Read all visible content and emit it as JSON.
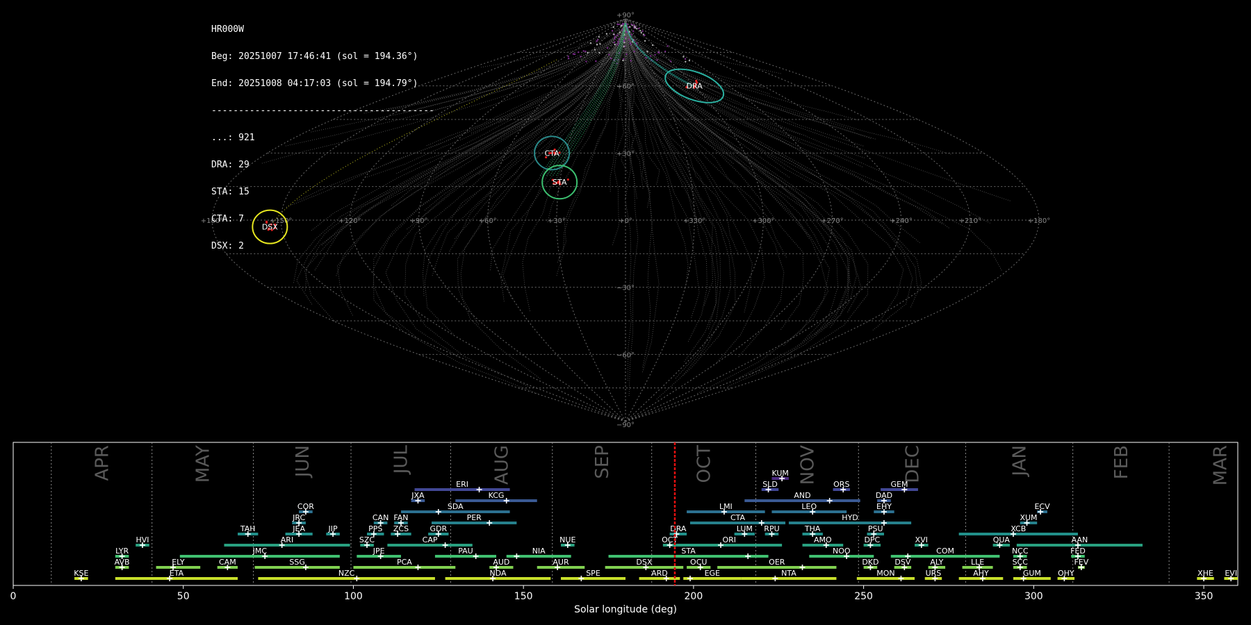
{
  "info": {
    "station": "HR000W",
    "beg": "Beg: 20251007 17:46:41 (sol = 194.36°)",
    "end": "End: 20251008 04:17:03 (sol = 194.79°)",
    "separator": "-----------------------------------------",
    "counts": [
      "...: 921",
      "DRA: 29",
      "STA: 15",
      "CTA: 7",
      "DSX: 2"
    ]
  },
  "sky_map": {
    "lon_labels": [
      "+180°",
      "+150°",
      "+120°",
      "+90°",
      "+60°",
      "+30°",
      "+0°",
      "+330°",
      "+300°",
      "+270°",
      "+240°",
      "+210°",
      "+180°"
    ],
    "lat_labels": [
      "+90°",
      "+60°",
      "+30°",
      "−30°",
      "−60°",
      "−90°"
    ],
    "showers": [
      {
        "code": "DRA",
        "lon": -60,
        "lat": 60,
        "color": "#2ab0a0"
      },
      {
        "code": "CTA",
        "lon": 37,
        "lat": 30,
        "color": "#2a8a8a"
      },
      {
        "code": "STA",
        "lon": 30,
        "lat": 17,
        "color": "#3cc070"
      },
      {
        "code": "DSX",
        "lon": 155,
        "lat": -3,
        "color": "#e8e820"
      }
    ]
  },
  "chart_data": {
    "type": "timeline",
    "xlabel": "Solar longitude (deg)",
    "xlim": [
      0,
      360
    ],
    "x_ticks": [
      "0",
      "50",
      "100",
      "150",
      "200",
      "250",
      "300",
      "350"
    ],
    "current_sol": 194.5,
    "months": [
      {
        "label": "APR",
        "start": 11.2
      },
      {
        "label": "MAY",
        "start": 40.8
      },
      {
        "label": "JUN",
        "start": 70.6
      },
      {
        "label": "JUL",
        "start": 99.3
      },
      {
        "label": "AUG",
        "start": 128.6
      },
      {
        "label": "SEP",
        "start": 158.5
      },
      {
        "label": "OCT",
        "start": 187.7
      },
      {
        "label": "NOV",
        "start": 218.3
      },
      {
        "label": "DEC",
        "start": 248.5
      },
      {
        "label": "JAN",
        "start": 280.0
      },
      {
        "label": "FEB",
        "start": 311.5
      },
      {
        "label": "MAR",
        "start": 339.8
      }
    ],
    "showers": [
      {
        "code": "KSE",
        "start": 18,
        "end": 22,
        "peak": 20,
        "row": 0,
        "color": "#c8df2a"
      },
      {
        "code": "ETA",
        "start": 30,
        "end": 66,
        "peak": 46,
        "row": 0,
        "color": "#c8df2a"
      },
      {
        "code": "NZC",
        "start": 72,
        "end": 124,
        "peak": 101,
        "row": 0,
        "color": "#c8df2a"
      },
      {
        "code": "NDA",
        "start": 127,
        "end": 158,
        "peak": 141,
        "row": 0,
        "color": "#c8df2a"
      },
      {
        "code": "SPE",
        "start": 161,
        "end": 180,
        "peak": 167,
        "row": 0,
        "color": "#c8df2a"
      },
      {
        "code": "ARD",
        "start": 184,
        "end": 196,
        "peak": 192,
        "row": 0,
        "color": "#c8df2a"
      },
      {
        "code": "EGE",
        "start": 197,
        "end": 214,
        "peak": 199,
        "row": 0,
        "color": "#c8df2a"
      },
      {
        "code": "NTA",
        "start": 214,
        "end": 242,
        "peak": 224,
        "row": 0,
        "color": "#c8df2a"
      },
      {
        "code": "MON",
        "start": 248,
        "end": 265,
        "peak": 261,
        "row": 0,
        "color": "#c8df2a"
      },
      {
        "code": "URS",
        "start": 268,
        "end": 273,
        "peak": 271,
        "row": 0,
        "color": "#c8df2a"
      },
      {
        "code": "AHY",
        "start": 278,
        "end": 291,
        "peak": 285,
        "row": 0,
        "color": "#c8df2a"
      },
      {
        "code": "GUM",
        "start": 294,
        "end": 305,
        "peak": 297,
        "row": 0,
        "color": "#c8df2a"
      },
      {
        "code": "OHY",
        "start": 307,
        "end": 312,
        "peak": 309,
        "row": 0,
        "color": "#c8df2a"
      },
      {
        "code": "XHE",
        "start": 348,
        "end": 353,
        "peak": 350,
        "row": 0,
        "color": "#c8df2a"
      },
      {
        "code": "EVI",
        "start": 356,
        "end": 360,
        "peak": 358,
        "row": 0,
        "color": "#c8df2a"
      },
      {
        "code": "AVB",
        "start": 30,
        "end": 34,
        "peak": 32,
        "row": 1,
        "color": "#80d050"
      },
      {
        "code": "ELY",
        "start": 42,
        "end": 55,
        "peak": 47,
        "row": 1,
        "color": "#80d050"
      },
      {
        "code": "CAM",
        "start": 60,
        "end": 66,
        "peak": 63,
        "row": 1,
        "color": "#80d050"
      },
      {
        "code": "SSG",
        "start": 71,
        "end": 96,
        "peak": 86,
        "row": 1,
        "color": "#80d050"
      },
      {
        "code": "PCA",
        "start": 100,
        "end": 130,
        "peak": 119,
        "row": 1,
        "color": "#80d050"
      },
      {
        "code": "AUD",
        "start": 140,
        "end": 147,
        "peak": 142,
        "row": 1,
        "color": "#80d050"
      },
      {
        "code": "AUR",
        "start": 154,
        "end": 168,
        "peak": 160,
        "row": 1,
        "color": "#80d050"
      },
      {
        "code": "DSX",
        "start": 174,
        "end": 197,
        "peak": 186,
        "row": 1,
        "color": "#80d050"
      },
      {
        "code": "OCU",
        "start": 198,
        "end": 205,
        "peak": 202,
        "row": 1,
        "color": "#80d050"
      },
      {
        "code": "OER",
        "start": 207,
        "end": 242,
        "peak": 232,
        "row": 1,
        "color": "#80d050"
      },
      {
        "code": "DKD",
        "start": 250,
        "end": 254,
        "peak": 252,
        "row": 1,
        "color": "#80d050"
      },
      {
        "code": "DSV",
        "start": 259,
        "end": 264,
        "peak": 262,
        "row": 1,
        "color": "#80d050"
      },
      {
        "code": "ALY",
        "start": 269,
        "end": 274,
        "peak": 271,
        "row": 1,
        "color": "#80d050"
      },
      {
        "code": "LLE",
        "start": 279,
        "end": 288,
        "peak": 284,
        "row": 1,
        "color": "#80d050"
      },
      {
        "code": "SCC",
        "start": 294,
        "end": 298,
        "peak": 296,
        "row": 1,
        "color": "#80d050"
      },
      {
        "code": "FEV",
        "start": 313,
        "end": 315,
        "peak": 314,
        "row": 1,
        "color": "#80d050"
      },
      {
        "code": "LYR",
        "start": 30,
        "end": 34,
        "peak": 32,
        "row": 2,
        "color": "#40c070"
      },
      {
        "code": "JMC",
        "start": 49,
        "end": 96,
        "peak": 74,
        "row": 2,
        "color": "#40c070"
      },
      {
        "code": "JPE",
        "start": 101,
        "end": 114,
        "peak": 108,
        "row": 2,
        "color": "#40c070"
      },
      {
        "code": "PAU",
        "start": 124,
        "end": 142,
        "peak": 136,
        "row": 2,
        "color": "#40c070"
      },
      {
        "code": "NIA",
        "start": 145,
        "end": 164,
        "peak": 148,
        "row": 2,
        "color": "#40c070"
      },
      {
        "code": "STA",
        "start": 175,
        "end": 222,
        "peak": 216,
        "row": 2,
        "color": "#40c070"
      },
      {
        "code": "NOO",
        "start": 234,
        "end": 253,
        "peak": 245,
        "row": 2,
        "color": "#40c070"
      },
      {
        "code": "COM",
        "start": 258,
        "end": 290,
        "peak": 263,
        "row": 2,
        "color": "#40c070"
      },
      {
        "code": "NCC",
        "start": 294,
        "end": 298,
        "peak": 296,
        "row": 2,
        "color": "#40c070"
      },
      {
        "code": "FED",
        "start": 311,
        "end": 315,
        "peak": 313,
        "row": 2,
        "color": "#40c070"
      },
      {
        "code": "HVI",
        "start": 36,
        "end": 40,
        "peak": 38,
        "row": 3,
        "color": "#28a080"
      },
      {
        "code": "ARI",
        "start": 62,
        "end": 99,
        "peak": 79,
        "row": 3,
        "color": "#28a080"
      },
      {
        "code": "SZC",
        "start": 102,
        "end": 106,
        "peak": 104,
        "row": 3,
        "color": "#28a080"
      },
      {
        "code": "CAP",
        "start": 110,
        "end": 135,
        "peak": 127,
        "row": 3,
        "color": "#28a080"
      },
      {
        "code": "NUE",
        "start": 161,
        "end": 165,
        "peak": 163,
        "row": 3,
        "color": "#28a080"
      },
      {
        "code": "OCT",
        "start": 191,
        "end": 195,
        "peak": 193,
        "row": 3,
        "color": "#28a080"
      },
      {
        "code": "ORI",
        "start": 195,
        "end": 226,
        "peak": 208,
        "row": 3,
        "color": "#28a080"
      },
      {
        "code": "AMO",
        "start": 232,
        "end": 244,
        "peak": 239,
        "row": 3,
        "color": "#28a080"
      },
      {
        "code": "DPC",
        "start": 250,
        "end": 255,
        "peak": 252,
        "row": 3,
        "color": "#28a080"
      },
      {
        "code": "XVI",
        "start": 265,
        "end": 269,
        "peak": 267,
        "row": 3,
        "color": "#28a080"
      },
      {
        "code": "QUA",
        "start": 288,
        "end": 293,
        "peak": 290,
        "row": 3,
        "color": "#28a080"
      },
      {
        "code": "AAN",
        "start": 295,
        "end": 332,
        "peak": 313,
        "row": 3,
        "color": "#28a080"
      },
      {
        "code": "TAH",
        "start": 66,
        "end": 72,
        "peak": 69,
        "row": 4,
        "color": "#22908a"
      },
      {
        "code": "JEA",
        "start": 80,
        "end": 88,
        "peak": 84,
        "row": 4,
        "color": "#22908a"
      },
      {
        "code": "JIP",
        "start": 92,
        "end": 96,
        "peak": 94,
        "row": 4,
        "color": "#22908a"
      },
      {
        "code": "PPS",
        "start": 104,
        "end": 109,
        "peak": 106,
        "row": 4,
        "color": "#22908a"
      },
      {
        "code": "ZCS",
        "start": 111,
        "end": 117,
        "peak": 113,
        "row": 4,
        "color": "#22908a"
      },
      {
        "code": "GDR",
        "start": 122,
        "end": 128,
        "peak": 125,
        "row": 4,
        "color": "#22908a"
      },
      {
        "code": "DRA",
        "start": 193,
        "end": 198,
        "peak": 195,
        "row": 4,
        "color": "#22908a"
      },
      {
        "code": "LUM",
        "start": 212,
        "end": 218,
        "peak": 215,
        "row": 4,
        "color": "#22908a"
      },
      {
        "code": "RPU",
        "start": 221,
        "end": 225,
        "peak": 223,
        "row": 4,
        "color": "#22908a"
      },
      {
        "code": "THA",
        "start": 232,
        "end": 238,
        "peak": 235,
        "row": 4,
        "color": "#22908a"
      },
      {
        "code": "PSU",
        "start": 251,
        "end": 256,
        "peak": 253,
        "row": 4,
        "color": "#22908a"
      },
      {
        "code": "XCB",
        "start": 278,
        "end": 313,
        "peak": 294,
        "row": 4,
        "color": "#22908a"
      },
      {
        "code": "JRC",
        "start": 82,
        "end": 86,
        "peak": 84,
        "row": 5,
        "color": "#26808c"
      },
      {
        "code": "CAN",
        "start": 106,
        "end": 110,
        "peak": 108,
        "row": 5,
        "color": "#26808c"
      },
      {
        "code": "FAN",
        "start": 112,
        "end": 116,
        "peak": 114,
        "row": 5,
        "color": "#26808c"
      },
      {
        "code": "PER",
        "start": 123,
        "end": 148,
        "peak": 140,
        "row": 5,
        "color": "#26808c"
      },
      {
        "code": "CTA",
        "start": 199,
        "end": 227,
        "peak": 220,
        "row": 5,
        "color": "#26808c"
      },
      {
        "code": "HYD",
        "start": 228,
        "end": 264,
        "peak": 256,
        "row": 5,
        "color": "#26808c"
      },
      {
        "code": "XUM",
        "start": 296,
        "end": 301,
        "peak": 298,
        "row": 5,
        "color": "#26808c"
      },
      {
        "code": "COR",
        "start": 84,
        "end": 88,
        "peak": 86,
        "row": 6,
        "color": "#2c7090"
      },
      {
        "code": "SDA",
        "start": 114,
        "end": 146,
        "peak": 125,
        "row": 6,
        "color": "#2c7090"
      },
      {
        "code": "LMI",
        "start": 198,
        "end": 221,
        "peak": 209,
        "row": 6,
        "color": "#2c7090"
      },
      {
        "code": "LEO",
        "start": 223,
        "end": 245,
        "peak": 235,
        "row": 6,
        "color": "#2c7090"
      },
      {
        "code": "EHY",
        "start": 253,
        "end": 259,
        "peak": 256,
        "row": 6,
        "color": "#2c7090"
      },
      {
        "code": "ECV",
        "start": 301,
        "end": 304,
        "peak": 302,
        "row": 6,
        "color": "#2c7090"
      },
      {
        "code": "JXA",
        "start": 117,
        "end": 121,
        "peak": 119,
        "row": 7,
        "color": "#3a5a94"
      },
      {
        "code": "KCG",
        "start": 130,
        "end": 154,
        "peak": 145,
        "row": 7,
        "color": "#3a5a94"
      },
      {
        "code": "AND",
        "start": 215,
        "end": 249,
        "peak": 240,
        "row": 7,
        "color": "#3a5a94"
      },
      {
        "code": "DAD",
        "start": 254,
        "end": 258,
        "peak": 256,
        "row": 7,
        "color": "#3a5a94"
      },
      {
        "code": "ERI",
        "start": 118,
        "end": 146,
        "peak": 137,
        "row": 8,
        "color": "#424896"
      },
      {
        "code": "SLD",
        "start": 220,
        "end": 225,
        "peak": 222,
        "row": 8,
        "color": "#424896"
      },
      {
        "code": "ORS",
        "start": 241,
        "end": 246,
        "peak": 244,
        "row": 8,
        "color": "#424896"
      },
      {
        "code": "GEM",
        "start": 255,
        "end": 266,
        "peak": 262,
        "row": 8,
        "color": "#424896"
      },
      {
        "code": "KUM",
        "start": 223,
        "end": 228,
        "peak": 226,
        "row": 9,
        "color": "#4b2a80"
      }
    ]
  }
}
